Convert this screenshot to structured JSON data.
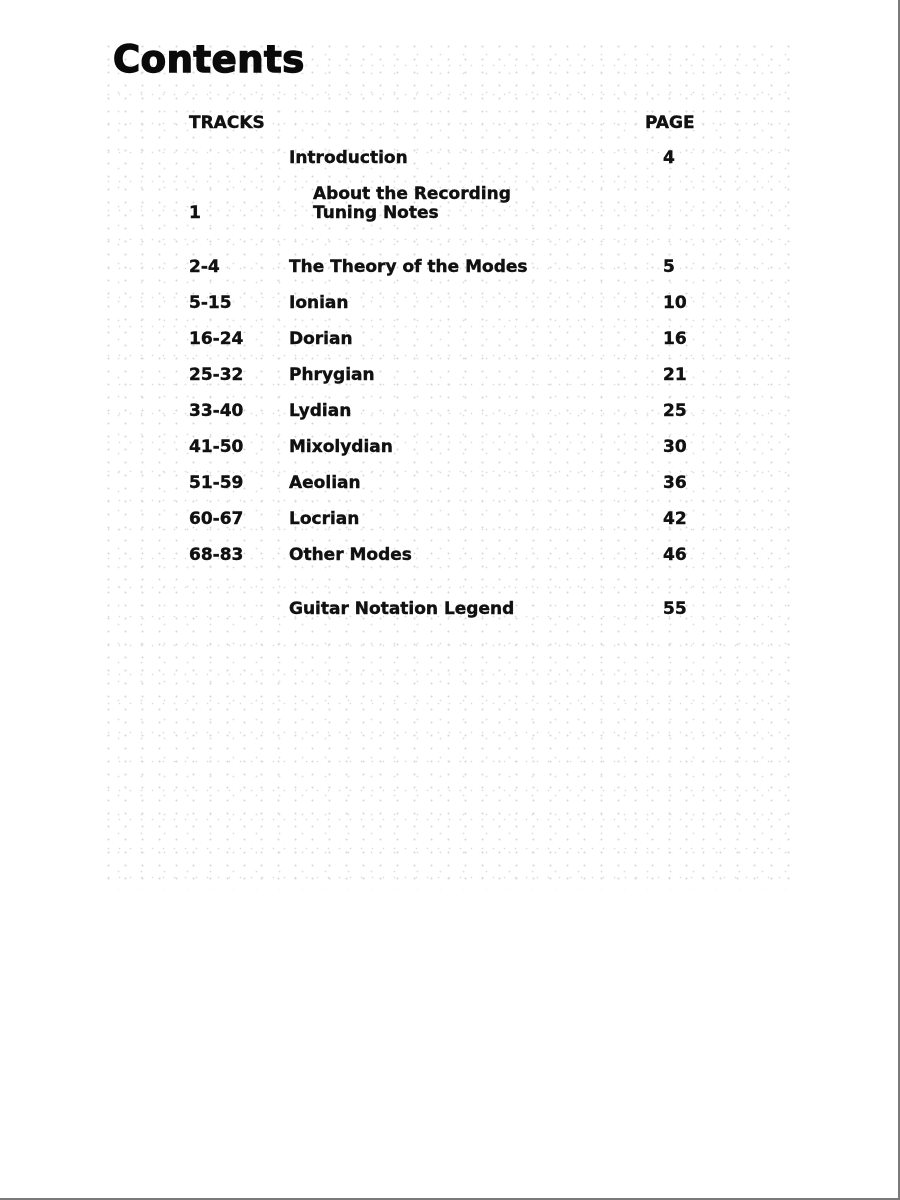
{
  "page": {
    "title": "Contents",
    "colors": {
      "text": "#111111",
      "background": "#ffffff",
      "frame": "#7a7a7a"
    }
  },
  "toc": {
    "headers": {
      "tracks": "TRACKS",
      "page": "PAGE"
    },
    "intro": {
      "tracks": "",
      "title": "Introduction",
      "page": "4"
    },
    "recording": {
      "tracks": "1",
      "titles": [
        "About the Recording",
        "Tuning Notes"
      ],
      "page": ""
    },
    "entries": [
      {
        "tracks": "2-4",
        "title": "The Theory of the Modes",
        "page": "5"
      },
      {
        "tracks": "5-15",
        "title": "Ionian",
        "page": "10"
      },
      {
        "tracks": "16-24",
        "title": "Dorian",
        "page": "16"
      },
      {
        "tracks": "25-32",
        "title": "Phrygian",
        "page": "21"
      },
      {
        "tracks": "33-40",
        "title": "Lydian",
        "page": "25"
      },
      {
        "tracks": "41-50",
        "title": "Mixolydian",
        "page": "30"
      },
      {
        "tracks": "51-59",
        "title": "Aeolian",
        "page": "36"
      },
      {
        "tracks": "60-67",
        "title": "Locrian",
        "page": "42"
      },
      {
        "tracks": "68-83",
        "title": "Other Modes",
        "page": "46"
      }
    ],
    "legend": {
      "tracks": "",
      "title": "Guitar Notation Legend",
      "page": "55"
    }
  }
}
